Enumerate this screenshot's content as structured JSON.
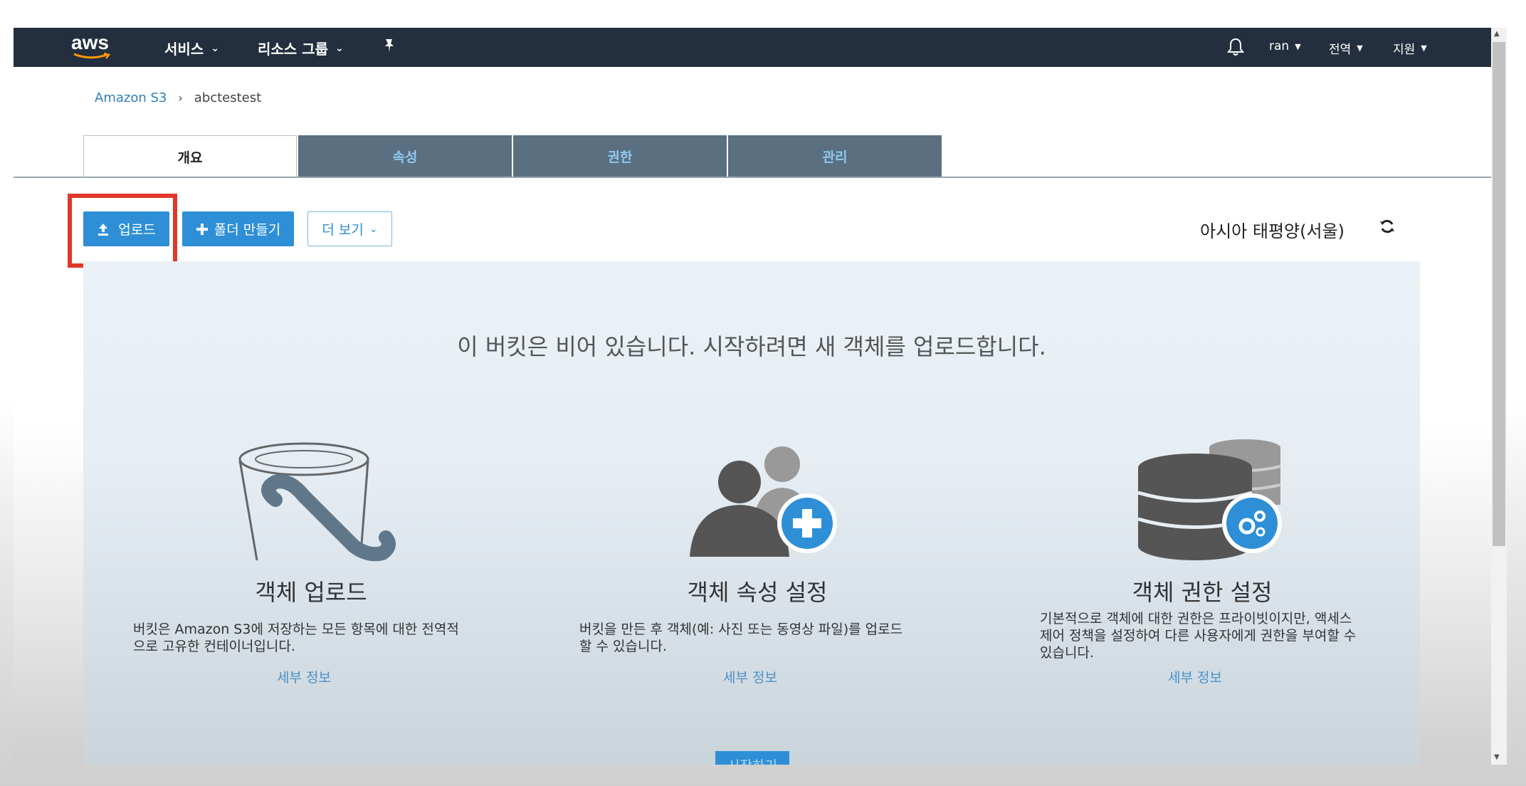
{
  "colors": {
    "nav_bg": "#232f3e",
    "primary_button": "#2e8fd7",
    "link": "#2e7fb8",
    "tab_inactive_bg": "#5a6f80",
    "highlight_border": "#e0382a"
  },
  "topnav": {
    "logo_text": "aws",
    "services_label": "서비스",
    "resource_groups_label": "리소스 그룹",
    "pin_icon": "pin-icon",
    "bell_icon": "bell-icon",
    "user_label": "ran",
    "region_menu_label": "전역",
    "support_label": "지원"
  },
  "breadcrumb": {
    "root": "Amazon S3",
    "separator": "›",
    "current": "abctestest"
  },
  "tabs": [
    {
      "label": "개요",
      "active": true
    },
    {
      "label": "속성",
      "active": false
    },
    {
      "label": "권한",
      "active": false
    },
    {
      "label": "관리",
      "active": false
    }
  ],
  "toolbar": {
    "upload_label": "업로드",
    "create_folder_label": "폴더 만들기",
    "more_label": "더 보기",
    "region_text": "아시아 태평양(서울)"
  },
  "empty_state": {
    "message": "이 버킷은 비어 있습니다. 시작하려면 새 객체를 업로드합니다.",
    "cards": [
      {
        "title": "객체 업로드",
        "desc_line1": "버킷은 Amazon S3에 저장하는 모든 항목에 대한 전역적",
        "desc_line2": "으로 고유한 컨테이너입니다.",
        "more": "세부 정보"
      },
      {
        "title": "객체 속성 설정",
        "desc_line1": "버킷을 만든 후 객체(예: 사진 또는 동영상 파일)를 업로드",
        "desc_line2": "할 수 있습니다.",
        "more": "세부 정보"
      },
      {
        "title": "객체 권한 설정",
        "desc_line1": "기본적으로 객체에 대한 권한은 프라이빗이지만, 액세스",
        "desc_line2": "제어 정책을 설정하여 다른 사용자에게 권한을 부여할 수",
        "desc_line3": "있습니다.",
        "more": "세부 정보"
      }
    ],
    "start_button": "시작하기"
  }
}
